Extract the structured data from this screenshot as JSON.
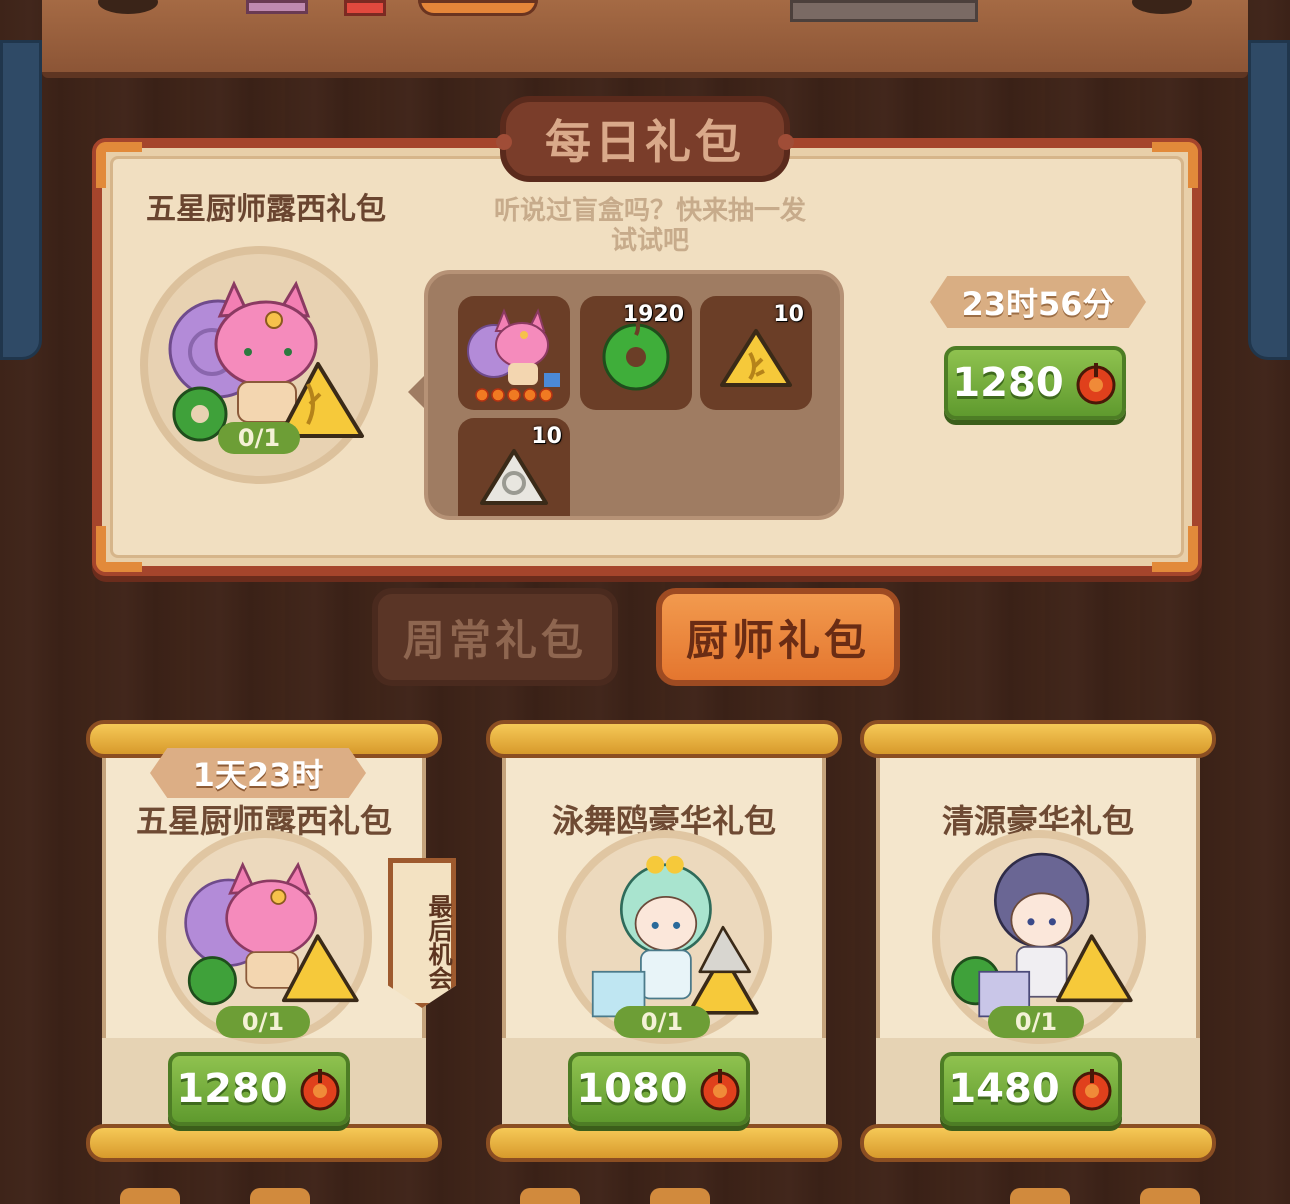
{
  "daily": {
    "title": "每日礼包",
    "pack_name": "五星厨师露西礼包",
    "description": "听说过盲盒吗？快来抽一发试试吧",
    "count": "0/1",
    "timer": "23时56分",
    "price": "1280",
    "items": [
      {
        "icon": "lucy-chef-icon",
        "qty": "",
        "stars": "5"
      },
      {
        "icon": "jade-coin-icon",
        "qty": "1920"
      },
      {
        "icon": "gold-rune-icon",
        "qty": "10"
      },
      {
        "icon": "silver-rune-icon",
        "qty": "10"
      }
    ]
  },
  "tabs": [
    {
      "label": "周常礼包",
      "active": false
    },
    {
      "label": "厨师礼包",
      "active": true
    }
  ],
  "cards": [
    {
      "title": "五星厨师露西礼包",
      "timer": "1天23时",
      "badge": "最后机会",
      "count": "0/1",
      "price": "1280"
    },
    {
      "title": "泳舞鸥豪华礼包",
      "count": "0/1",
      "price": "1080"
    },
    {
      "title": "清源豪华礼包",
      "count": "0/1",
      "price": "1480"
    }
  ],
  "colors": {
    "frame": "#a5452c",
    "price_green": "#6fa83a",
    "tab_active": "#ee8a40"
  }
}
